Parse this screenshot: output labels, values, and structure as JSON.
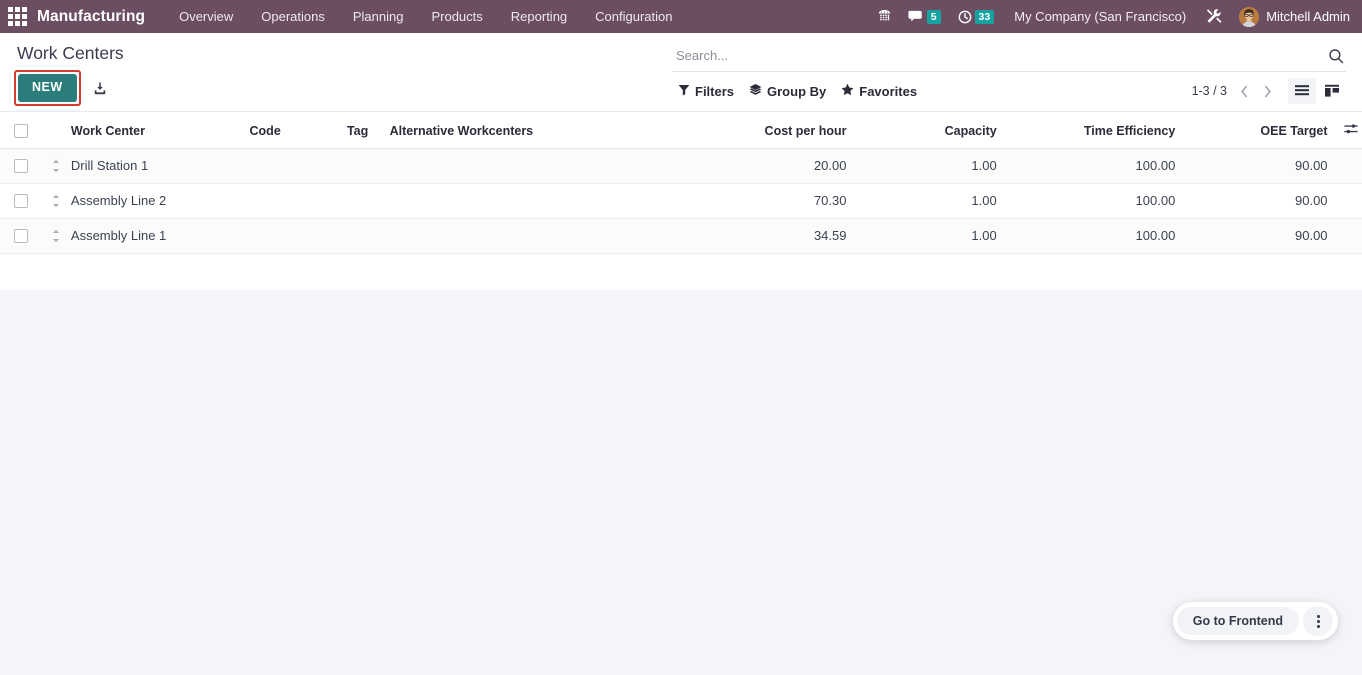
{
  "navbar": {
    "apps_icon": "apps-grid-icon",
    "brand": "Manufacturing",
    "menu": [
      {
        "label": "Overview"
      },
      {
        "label": "Operations"
      },
      {
        "label": "Planning"
      },
      {
        "label": "Products"
      },
      {
        "label": "Reporting"
      },
      {
        "label": "Configuration"
      }
    ],
    "systray": {
      "phone_icon": "phone-dialpad-icon",
      "messages_icon": "chat-bubble-icon",
      "messages_count": "5",
      "activities_icon": "clock-icon",
      "activities_count": "33",
      "company": "My Company (San Francisco)",
      "tools_icon": "tools-icon",
      "avatar_icon": "user-avatar",
      "user": "Mitchell Admin"
    }
  },
  "control_panel": {
    "breadcrumb": "Work Centers",
    "new_label": "NEW",
    "import_icon": "import-download-icon",
    "new_highlight_color": "#d23c2e",
    "new_button_color": "#2a7d7b"
  },
  "search": {
    "placeholder": "Search...",
    "value": "",
    "magnifier_icon": "search-icon",
    "filters_label": "Filters",
    "filters_icon": "filter-funnel-icon",
    "group_by_label": "Group By",
    "group_by_icon": "layers-icon",
    "favorites_label": "Favorites",
    "favorites_icon": "star-icon"
  },
  "pager": {
    "range": "1-3 / 3",
    "prev_icon": "chevron-left-icon",
    "next_icon": "chevron-right-icon"
  },
  "view_switcher": {
    "list_icon": "list-view-icon",
    "kanban_icon": "kanban-view-icon",
    "active": "list"
  },
  "table": {
    "select_all_icon": "checkbox",
    "options_icon": "column-options-icon",
    "columns": [
      {
        "key": "name",
        "label": "Work Center",
        "align": "left"
      },
      {
        "key": "code",
        "label": "Code",
        "align": "left"
      },
      {
        "key": "tag",
        "label": "Tag",
        "align": "left"
      },
      {
        "key": "alt",
        "label": "Alternative Workcenters",
        "align": "left"
      },
      {
        "key": "cost",
        "label": "Cost per hour",
        "align": "right"
      },
      {
        "key": "capacity",
        "label": "Capacity",
        "align": "right"
      },
      {
        "key": "efficiency",
        "label": "Time Efficiency",
        "align": "right"
      },
      {
        "key": "oee",
        "label": "OEE Target",
        "align": "right"
      }
    ],
    "rows": [
      {
        "name": "Drill Station 1",
        "code": "",
        "tag": "",
        "alt": "",
        "cost": "20.00",
        "capacity": "1.00",
        "efficiency": "100.00",
        "oee": "90.00"
      },
      {
        "name": "Assembly Line 2",
        "code": "",
        "tag": "",
        "alt": "",
        "cost": "70.30",
        "capacity": "1.00",
        "efficiency": "100.00",
        "oee": "90.00"
      },
      {
        "name": "Assembly Line 1",
        "code": "",
        "tag": "",
        "alt": "",
        "cost": "34.59",
        "capacity": "1.00",
        "efficiency": "100.00",
        "oee": "90.00"
      }
    ]
  },
  "frontend_widget": {
    "label": "Go to Frontend",
    "kebab_icon": "more-vertical-icon"
  }
}
